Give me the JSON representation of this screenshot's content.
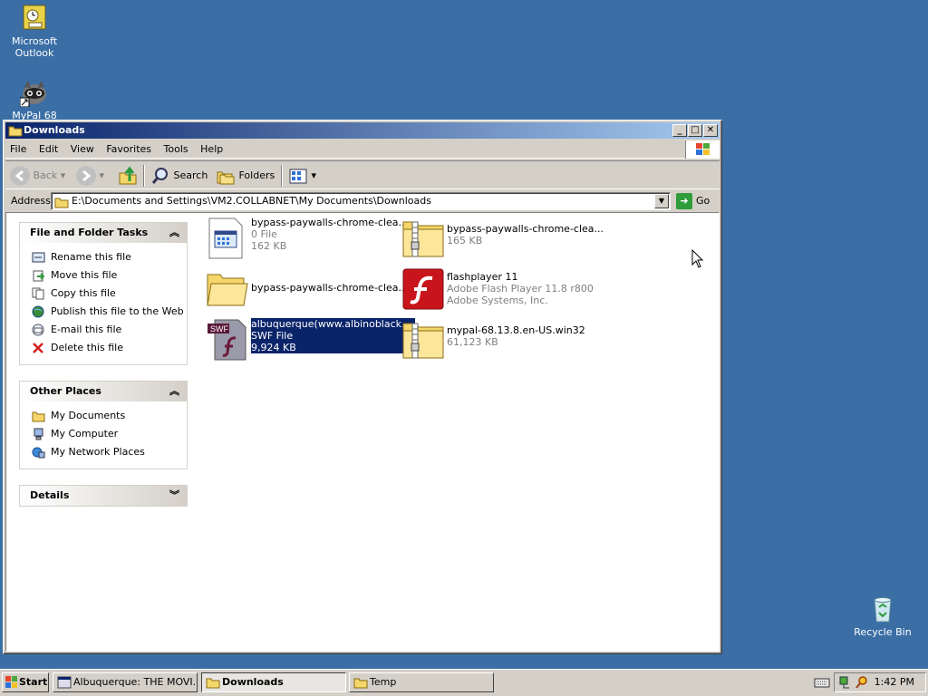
{
  "desktop": {
    "icons": [
      {
        "label": "Microsoft Outlook",
        "icon": "outlook-icon"
      },
      {
        "label": "MyPal 68",
        "icon": "mypal-icon"
      },
      {
        "label": "Recycle Bin",
        "icon": "recycle-bin-icon"
      }
    ]
  },
  "window": {
    "title": "Downloads",
    "menu": [
      "File",
      "Edit",
      "View",
      "Favorites",
      "Tools",
      "Help"
    ],
    "toolbar": {
      "back": "Back",
      "search": "Search",
      "folders": "Folders"
    },
    "address": {
      "label": "Address",
      "value": "E:\\Documents and Settings\\VM2.COLLABNET\\My Documents\\Downloads",
      "go": "Go"
    },
    "tasks": {
      "file_folder": {
        "title": "File and Folder Tasks",
        "items": [
          "Rename this file",
          "Move this file",
          "Copy this file",
          "Publish this file to the Web",
          "E-mail this file",
          "Delete this file"
        ]
      },
      "other_places": {
        "title": "Other Places",
        "items": [
          "My Documents",
          "My Computer",
          "My Network Places"
        ]
      },
      "details": {
        "title": "Details"
      }
    },
    "files": [
      {
        "name": "bypass-paywalls-chrome-clea...",
        "line2": "0 File",
        "line3": "162 KB",
        "icon": "file-icon"
      },
      {
        "name": "bypass-paywalls-chrome-clea...",
        "line2": "165 KB",
        "line3": "",
        "icon": "zip-folder-icon"
      },
      {
        "name": "bypass-paywalls-chrome-clea...",
        "line2": "",
        "line3": "",
        "icon": "folder-icon"
      },
      {
        "name": "flashplayer 11",
        "line2": "Adobe Flash Player 11.8 r800",
        "line3": "Adobe Systems, Inc.",
        "icon": "flash-icon"
      },
      {
        "name": "albuquerque(www.albinoblack...",
        "line2": "SWF File",
        "line3": "9,924 KB",
        "icon": "swf-icon",
        "selected": true
      },
      {
        "name": "mypal-68.13.8.en-US.win32",
        "line2": "61,123 KB",
        "line3": "",
        "icon": "zip-folder-icon"
      }
    ]
  },
  "taskbar": {
    "start": "Start",
    "buttons": [
      {
        "label": "Albuquerque: THE MOVI...",
        "active": false
      },
      {
        "label": "Downloads",
        "active": true
      },
      {
        "label": "Temp",
        "active": false
      }
    ],
    "clock": "1:42 PM"
  }
}
